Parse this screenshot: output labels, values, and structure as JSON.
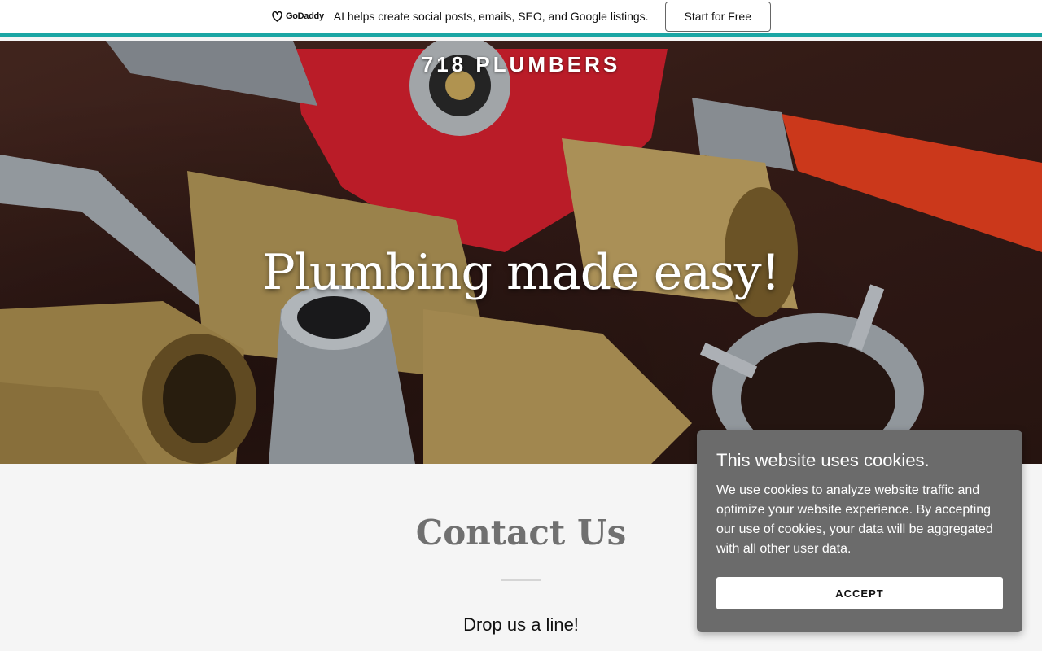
{
  "promo": {
    "logo_text": "GoDaddy",
    "message": "AI helps create social posts, emails, SEO, and Google listings.",
    "cta_label": "Start for Free"
  },
  "hero": {
    "site_title": "718 PLUMBERS",
    "heading": "Plumbing made easy!"
  },
  "contact": {
    "title": "Contact Us",
    "subtitle": "Drop us a line!"
  },
  "cookie_banner": {
    "title": "This website uses cookies.",
    "body": "We use cookies to analyze website traffic and optimize your website experience. By accepting our use of cookies, your data will be aggregated with all other user data.",
    "accept_label": "ACCEPT"
  },
  "colors": {
    "accent_teal": "#1ba6a4",
    "cookie_bg": "#6b6b6b",
    "valve_red": "#d4202e"
  }
}
